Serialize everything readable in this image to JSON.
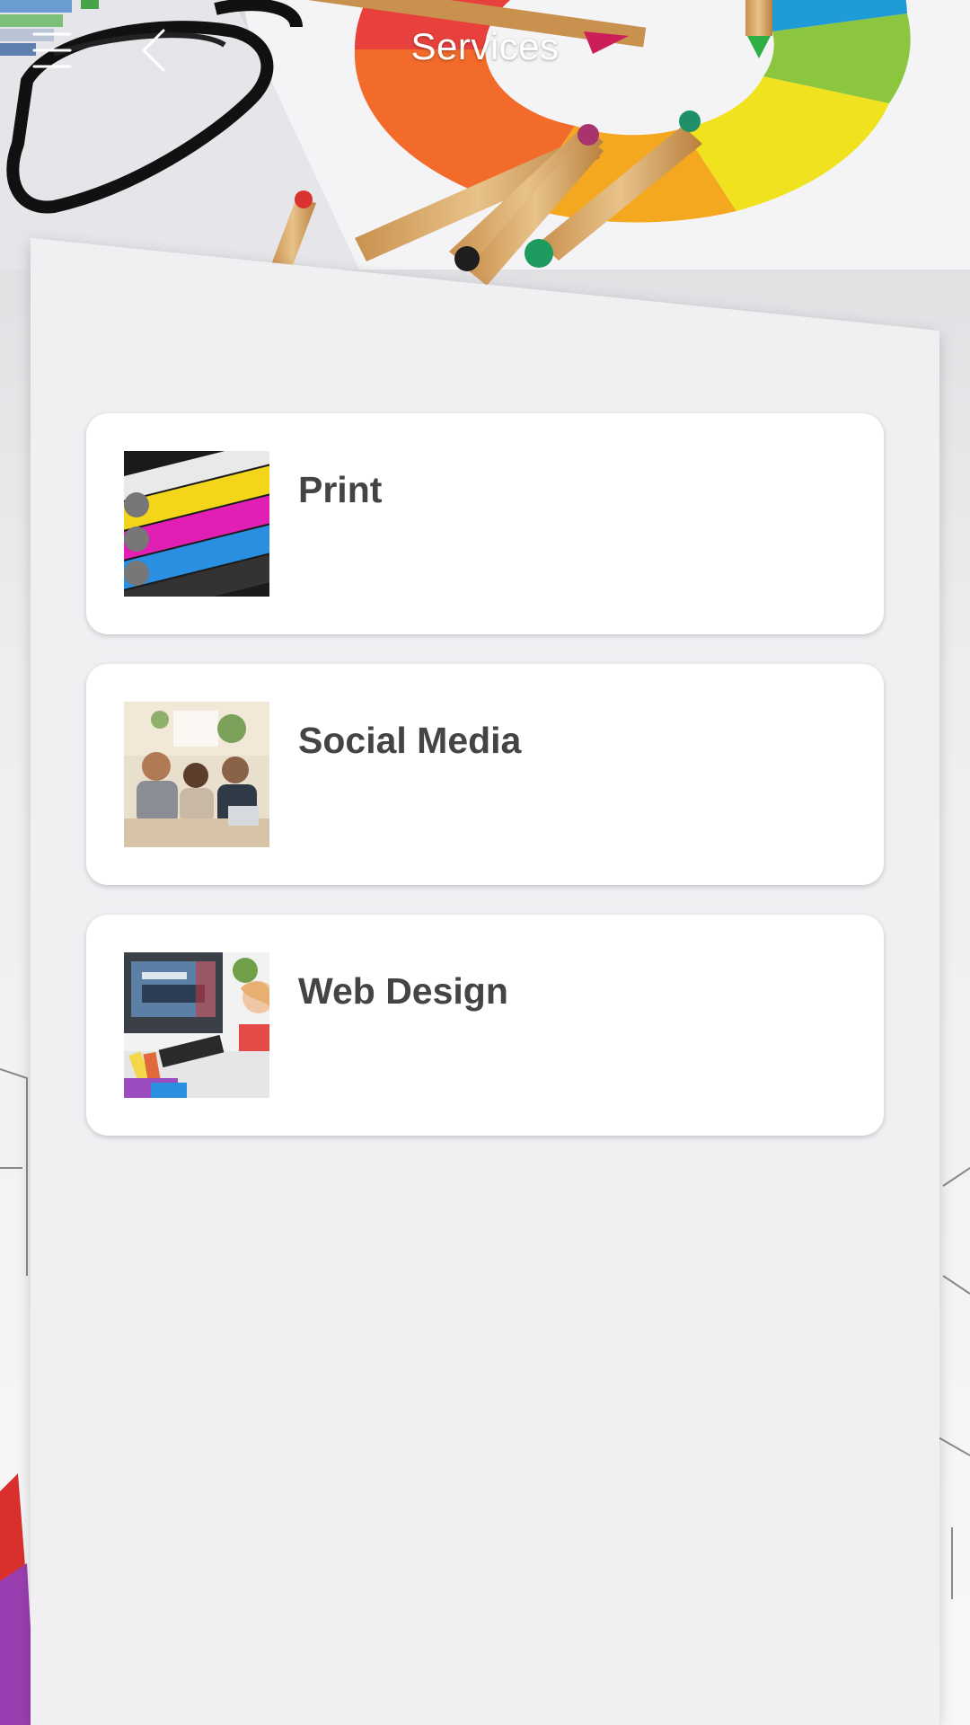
{
  "header": {
    "title": "Services",
    "menu_icon": "hamburger-menu-icon",
    "back_icon": "chevron-left-icon"
  },
  "services": [
    {
      "label": "Print",
      "image": "printing-press-rollers-image"
    },
    {
      "label": "Social Media",
      "image": "people-meeting-image"
    },
    {
      "label": "Web Design",
      "image": "designer-at-desk-image"
    }
  ],
  "colors": {
    "panel_background": "#f1eff2",
    "card_background": "#ffffff",
    "card_text": "#444444",
    "header_text": "#ffffff"
  }
}
